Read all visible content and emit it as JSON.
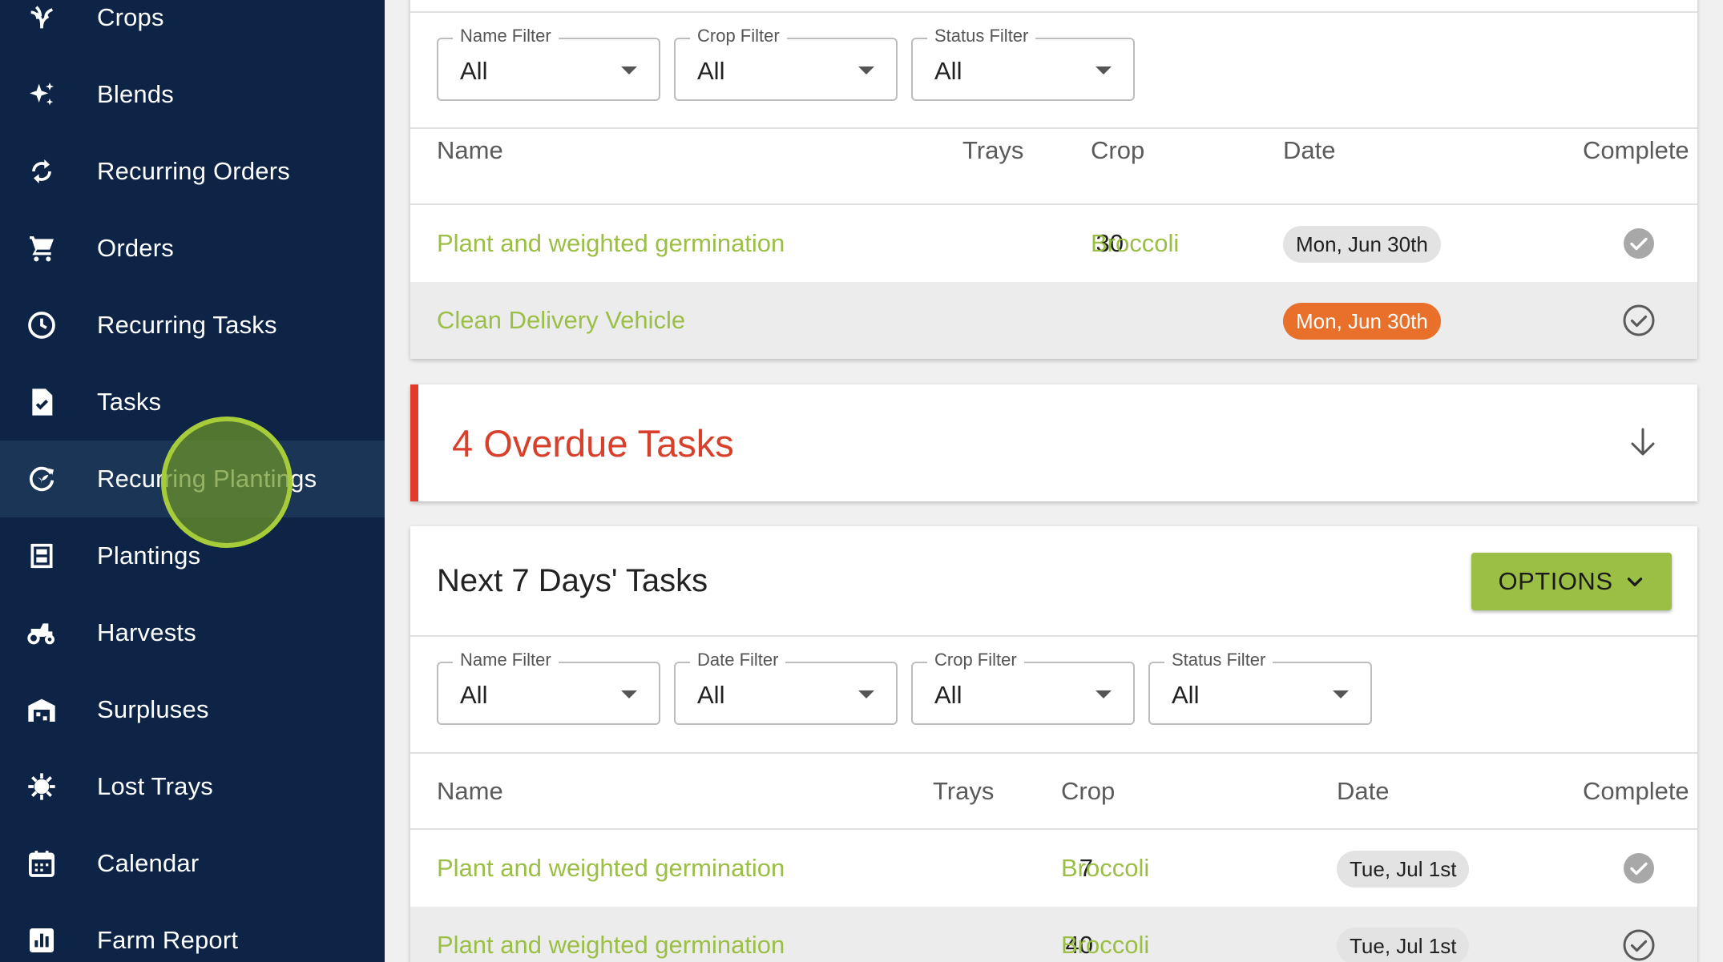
{
  "sidebar": {
    "items": [
      {
        "label": "Crops",
        "icon": "sprout-icon"
      },
      {
        "label": "Blends",
        "icon": "sparkle-icon"
      },
      {
        "label": "Recurring Orders",
        "icon": "sync-icon"
      },
      {
        "label": "Orders",
        "icon": "cart-icon"
      },
      {
        "label": "Recurring Tasks",
        "icon": "clock-icon"
      },
      {
        "label": "Tasks",
        "icon": "task-file-icon"
      },
      {
        "label": "Recurring Plantings",
        "icon": "recurring-planting-icon",
        "active": true
      },
      {
        "label": "Plantings",
        "icon": "tray-rack-icon"
      },
      {
        "label": "Harvests",
        "icon": "tractor-icon"
      },
      {
        "label": "Surpluses",
        "icon": "warehouse-icon"
      },
      {
        "label": "Lost Trays",
        "icon": "virus-icon"
      },
      {
        "label": "Calendar",
        "icon": "calendar-icon"
      },
      {
        "label": "Farm Report",
        "icon": "bar-chart-icon"
      }
    ]
  },
  "today_tasks": {
    "filters": [
      {
        "label": "Name Filter",
        "value": "All"
      },
      {
        "label": "Crop Filter",
        "value": "All"
      },
      {
        "label": "Status Filter",
        "value": "All"
      }
    ],
    "columns": {
      "name": "Name",
      "trays": "Trays",
      "crop": "Crop",
      "date": "Date",
      "complete": "Complete"
    },
    "rows": [
      {
        "name": "Plant and weighted germination",
        "trays": "30",
        "crop": "Broccoli",
        "date": "Mon, Jun 30th",
        "date_status": "normal",
        "complete_style": "filled"
      },
      {
        "name": "Clean Delivery Vehicle",
        "trays": "",
        "crop": "",
        "date": "Mon, Jun 30th",
        "date_status": "overdue",
        "complete_style": "outline"
      }
    ]
  },
  "overdue": {
    "title": "4 Overdue Tasks"
  },
  "next_tasks": {
    "title": "Next 7 Days' Tasks",
    "options_label": "OPTIONS",
    "filters": [
      {
        "label": "Name Filter",
        "value": "All"
      },
      {
        "label": "Date Filter",
        "value": "All"
      },
      {
        "label": "Crop Filter",
        "value": "All"
      },
      {
        "label": "Status Filter",
        "value": "All"
      }
    ],
    "columns": {
      "name": "Name",
      "trays": "Trays",
      "crop": "Crop",
      "date": "Date",
      "complete": "Complete"
    },
    "rows": [
      {
        "name": "Plant and weighted germination",
        "trays": "7",
        "crop": "Broccoli",
        "date": "Tue, Jul 1st",
        "complete_style": "filled"
      },
      {
        "name": "Plant and weighted germination",
        "trays": "40",
        "crop": "Broccoli",
        "date": "Tue, Jul 1st",
        "complete_style": "outline"
      }
    ]
  },
  "colors": {
    "sidebar_bg": "#0d2446",
    "accent_green": "#9bbf45",
    "overdue_red": "#d9402b",
    "overdue_chip": "#e8702a"
  }
}
